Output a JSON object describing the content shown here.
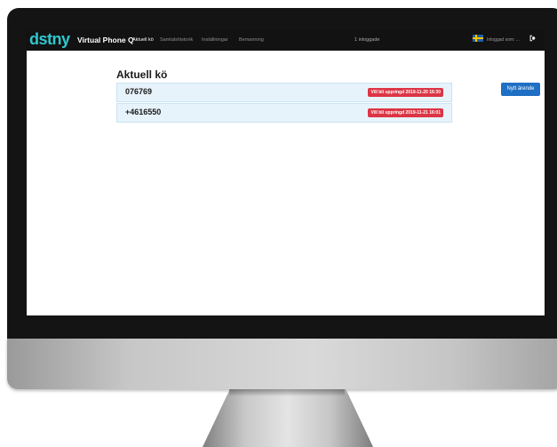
{
  "navbar": {
    "brand": "dstny",
    "app_name": "Virtual Phone Q",
    "links": [
      "Aktuell kö",
      "Samtalshistorik",
      "Inställningar",
      "Bemanning"
    ],
    "logged_in_count": "1 inloggade",
    "user": "Inloggad som: ..."
  },
  "main": {
    "title": "Aktuell kö",
    "new_case_label": "Nytt ärende",
    "queue": [
      {
        "number": "076769",
        "status": "Vill bli uppringd 2019-11-20 16:30"
      },
      {
        "number": "+4616550",
        "status": "Vill bli uppringd 2019-11-21 16:01"
      }
    ]
  },
  "colors": {
    "brand": "#2ec8cf",
    "navbar": "#121212",
    "primary_button": "#1f6fc4",
    "badge": "#dc3545",
    "row_bg": "#e7f3fb"
  },
  "icons": [
    "swedish-flag-icon",
    "logout-icon"
  ]
}
